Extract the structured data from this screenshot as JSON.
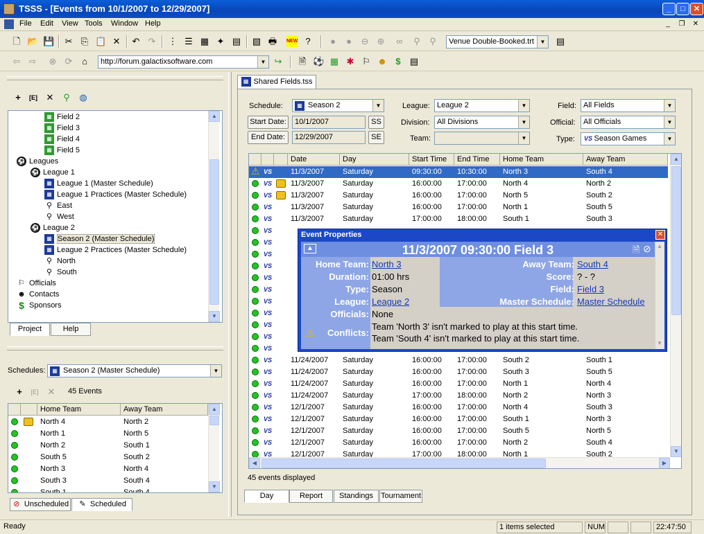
{
  "window": {
    "title": "TSSS - [Events from 10/1/2007 to 12/29/2007]"
  },
  "menu": [
    "File",
    "Edit",
    "View",
    "Tools",
    "Window",
    "Help"
  ],
  "toolbar": {
    "filter_value": "Venue Double-Booked.trt",
    "url": "http://forum.galactixsoftware.com"
  },
  "project_tree": {
    "items": [
      {
        "label": "Field 2",
        "indent": 2,
        "icon": "field"
      },
      {
        "label": "Field 3",
        "indent": 2,
        "icon": "field"
      },
      {
        "label": "Field 4",
        "indent": 2,
        "icon": "field"
      },
      {
        "label": "Field 5",
        "indent": 2,
        "icon": "field"
      },
      {
        "label": "Leagues",
        "indent": 0,
        "icon": "ball"
      },
      {
        "label": "League 1",
        "indent": 1,
        "icon": "ball"
      },
      {
        "label": "League 1 (Master Schedule)",
        "indent": 2,
        "icon": "schedule"
      },
      {
        "label": "League 1 Practices (Master Schedule)",
        "indent": 2,
        "icon": "schedule"
      },
      {
        "label": "East",
        "indent": 2,
        "icon": "division"
      },
      {
        "label": "West",
        "indent": 2,
        "icon": "division"
      },
      {
        "label": "League 2",
        "indent": 1,
        "icon": "ball"
      },
      {
        "label": "Season 2 (Master Schedule)",
        "indent": 2,
        "icon": "schedule",
        "selected": true
      },
      {
        "label": "League 2 Practices (Master Schedule)",
        "indent": 2,
        "icon": "schedule"
      },
      {
        "label": "North",
        "indent": 2,
        "icon": "division"
      },
      {
        "label": "South",
        "indent": 2,
        "icon": "division"
      },
      {
        "label": "Officials",
        "indent": 0,
        "icon": "whistle"
      },
      {
        "label": "Contacts",
        "indent": 0,
        "icon": "contact"
      },
      {
        "label": "Sponsors",
        "indent": 0,
        "icon": "dollar"
      }
    ],
    "tabs": [
      "Project",
      "Help"
    ]
  },
  "schedules_panel": {
    "label": "Schedules:",
    "value": "Season 2 (Master Schedule)",
    "event_count": "45 Events",
    "columns": [
      "Home Team",
      "Away Team"
    ],
    "rows": [
      [
        "North 4",
        "North 2"
      ],
      [
        "North 1",
        "North 5"
      ],
      [
        "North 2",
        "South 1"
      ],
      [
        "South 5",
        "South 2"
      ],
      [
        "North 3",
        "North 4"
      ],
      [
        "South 3",
        "South 4"
      ],
      [
        "South 1",
        "South 4"
      ]
    ],
    "tabs": [
      "Unscheduled",
      "Scheduled"
    ]
  },
  "doc_tab": "Shared Fields.tss",
  "filters": {
    "schedule_label": "Schedule:",
    "schedule": "Season 2",
    "start_btn": "Start Date:",
    "start_date": "10/1/2007",
    "end_btn": "End Date:",
    "end_date": "12/29/2007",
    "ss": "SS",
    "se": "SE",
    "league_label": "League:",
    "league": "League 2",
    "division_label": "Division:",
    "division": "All Divisions",
    "team_label": "Team:",
    "team": "",
    "field_label": "Field:",
    "field": "All Fields",
    "official_label": "Official:",
    "official": "All Officials",
    "type_label": "Type:",
    "type": "Season Games"
  },
  "grid": {
    "columns": [
      "Date",
      "Day",
      "Start Time",
      "End Time",
      "Home Team",
      "Away Team"
    ],
    "rows": [
      [
        "11/3/2007",
        "Saturday",
        "09:30:00",
        "10:30:00",
        "North 3",
        "South 4"
      ],
      [
        "11/3/2007",
        "Saturday",
        "16:00:00",
        "17:00:00",
        "North 4",
        "North 2"
      ],
      [
        "11/3/2007",
        "Saturday",
        "16:00:00",
        "17:00:00",
        "North 5",
        "South 2"
      ],
      [
        "11/3/2007",
        "Saturday",
        "16:00:00",
        "17:00:00",
        "North 1",
        "South 5"
      ],
      [
        "11/3/2007",
        "Saturday",
        "17:00:00",
        "18:00:00",
        "South 1",
        "South 3"
      ],
      [
        "11/24/2007",
        "Saturday",
        "16:00:00",
        "17:00:00",
        "South 2",
        "South 1"
      ],
      [
        "11/24/2007",
        "Saturday",
        "16:00:00",
        "17:00:00",
        "South 3",
        "South 5"
      ],
      [
        "11/24/2007",
        "Saturday",
        "16:00:00",
        "17:00:00",
        "North 1",
        "North 4"
      ],
      [
        "11/24/2007",
        "Saturday",
        "17:00:00",
        "18:00:00",
        "North 2",
        "North 3"
      ],
      [
        "12/1/2007",
        "Saturday",
        "16:00:00",
        "17:00:00",
        "North 4",
        "South 3"
      ],
      [
        "12/1/2007",
        "Saturday",
        "16:00:00",
        "17:00:00",
        "South 1",
        "North 3"
      ],
      [
        "12/1/2007",
        "Saturday",
        "16:00:00",
        "17:00:00",
        "South 5",
        "North 5"
      ],
      [
        "12/1/2007",
        "Saturday",
        "16:00:00",
        "17:00:00",
        "North 2",
        "South 4"
      ],
      [
        "12/1/2007",
        "Saturday",
        "17:00:00",
        "18:00:00",
        "North 1",
        "South 2"
      ]
    ],
    "footer": "45 events displayed"
  },
  "bottom_tabs": [
    "Day",
    "Report",
    "Standings",
    "Tournament"
  ],
  "popup": {
    "title": "Event Properties",
    "heading": "11/3/2007 09:30:00 Field 3",
    "home_label": "Home Team:",
    "home": "North 3",
    "away_label": "Away Team:",
    "away": "South 4",
    "duration_label": "Duration:",
    "duration": "01:00 hrs",
    "score_label": "Score:",
    "score": "? - ?",
    "type_label": "Type:",
    "type": "Season",
    "field_label": "Field:",
    "field": "Field 3",
    "league_label": "League:",
    "league": "League 2",
    "master_label": "Master Schedule:",
    "master": "Master Schedule",
    "officials_label": "Officials:",
    "officials": "None",
    "conflicts_label": "Conflicts:",
    "conflict1": "Team 'North 3' isn't marked to play at this start time.",
    "conflict2": "Team 'South 4' isn't marked to play at this start time."
  },
  "status": {
    "ready": "Ready",
    "selected": "1 items selected",
    "num": "NUM",
    "time": "22:47:50"
  }
}
